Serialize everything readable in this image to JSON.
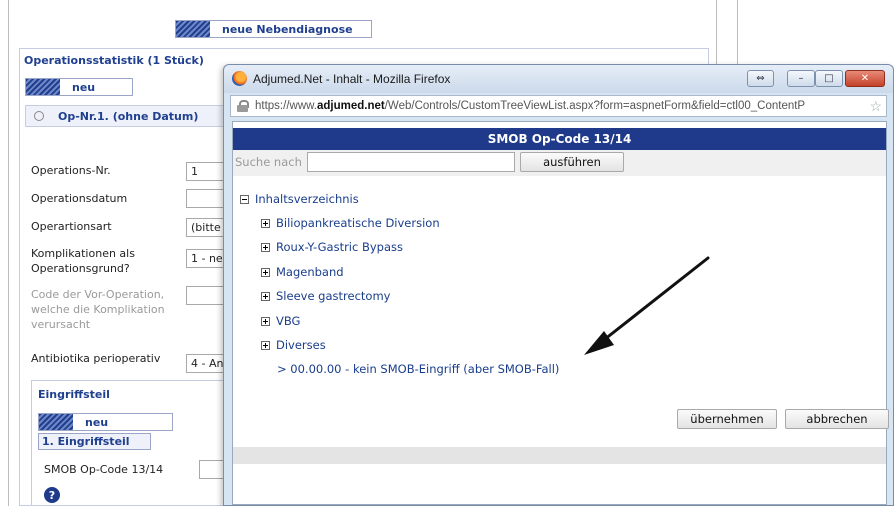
{
  "background": {
    "top_button": "neue Nebendiagnose",
    "section_title": "Operationsstatistik (1 Stück)",
    "new_button": "neu",
    "op_header": "Op-Nr.1. (ohne Datum)",
    "fields": [
      {
        "label": "Operations-Nr.",
        "value": "1"
      },
      {
        "label": "Operationsdatum",
        "value": ""
      },
      {
        "label": "Operartionsart",
        "value": "(bitte"
      },
      {
        "label": "Komplikationen als Operationsgrund?",
        "value": "1 - ne"
      },
      {
        "label": "Code der Vor-Operation, welche die Komplikation verursacht",
        "value": ""
      },
      {
        "label": "Antibiotika perioperativ",
        "value": "4 - An"
      }
    ],
    "eingriff_title": "Eingriffsteil",
    "eingriff_new": "neu",
    "eingriff_tab": "1. Eingriffsteil",
    "smob_label": "SMOB Op-Code 13/14",
    "help_icon": "?"
  },
  "popup": {
    "window_title": "Adjumed.Net - Inhalt - Mozilla Firefox",
    "url_prefix": "https://www.",
    "url_domain": "adjumed.net",
    "url_rest": "/Web/Controls/CustomTreeViewList.aspx?form=aspnetForm&field=ctl00_ContentP",
    "header": "SMOB Op-Code 13/14",
    "search_label": "Suche nach",
    "search_value": "",
    "search_button": "ausführen",
    "tree_root": "Inhaltsverzeichnis",
    "tree_items": [
      "Biliopankreatische Diversion",
      "Roux-Y-Gastric Bypass",
      "Magenband",
      "Sleeve gastrectomy",
      "VBG",
      "Diverses"
    ],
    "leaf_item": "> 00.00.00 - kein SMOB-Eingriff (aber SMOB-Fall)",
    "ok_button": "übernehmen",
    "cancel_button": "abbrechen",
    "window_controls": {
      "restore": "⇔",
      "minimize": "–",
      "maximize": "□",
      "close": "✕"
    }
  }
}
